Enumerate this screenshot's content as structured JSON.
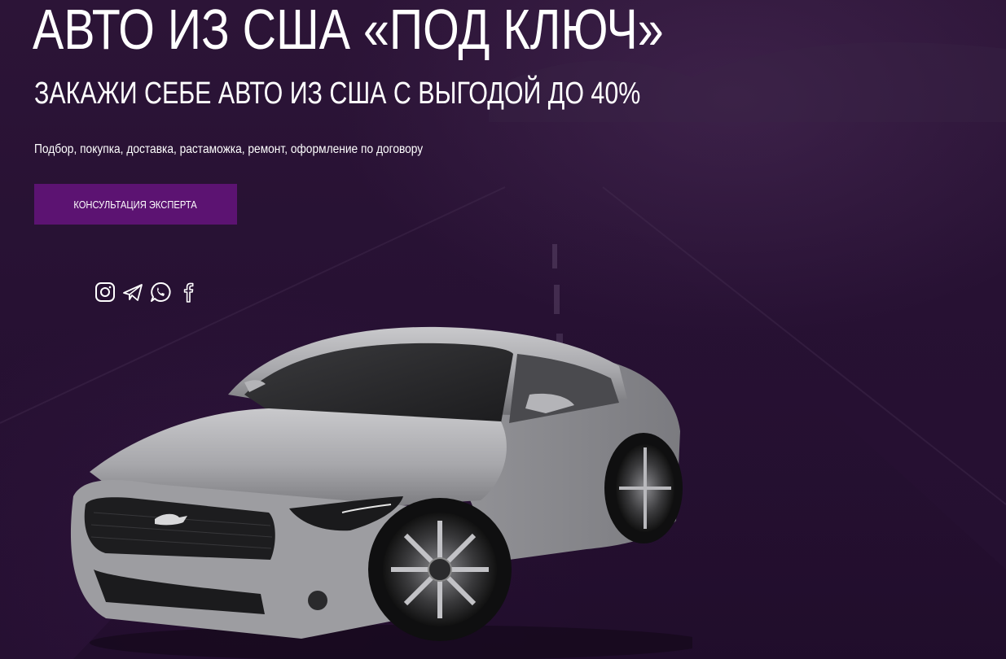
{
  "hero": {
    "title": "АВТО ИЗ США «ПОД КЛЮЧ»",
    "subtitle": "ЗАКАЖИ СЕБЕ АВТО ИЗ США С ВЫГОДОЙ ДО 40%",
    "description": "Подбор, покупка, доставка, растаможка, ремонт, оформление по договору",
    "cta_label": "КОНСУЛЬТАЦИЯ ЭКСПЕРТА"
  },
  "social": {
    "icons": [
      "instagram-icon",
      "telegram-icon",
      "whatsapp-icon",
      "facebook-icon"
    ]
  },
  "colors": {
    "background": "#2a1236",
    "cta_background": "#5c1372",
    "text": "#ffffff"
  }
}
